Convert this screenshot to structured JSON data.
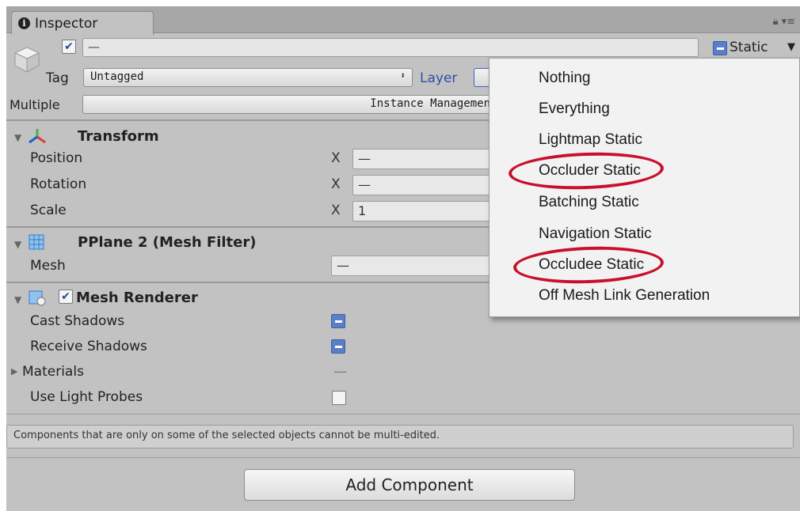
{
  "tab": {
    "title": "Inspector"
  },
  "header": {
    "name_value": "—",
    "static_label": "Static",
    "tag_label": "Tag",
    "tag_value": "Untagged",
    "layer_label": "Layer",
    "multiple_label": "Multiple",
    "multiple_value": "Instance Managemen"
  },
  "transform": {
    "title": "Transform",
    "rows": [
      {
        "label": "Position",
        "axis": "X",
        "value": "—"
      },
      {
        "label": "Rotation",
        "axis": "X",
        "value": "—"
      },
      {
        "label": "Scale",
        "axis": "X",
        "value": "1"
      }
    ]
  },
  "mesh_filter": {
    "title": "PPlane 2 (Mesh Filter)",
    "mesh_label": "Mesh",
    "mesh_value": "—"
  },
  "mesh_renderer": {
    "title": "Mesh Renderer",
    "cast_shadows": "Cast Shadows",
    "receive_shadows": "Receive Shadows",
    "materials": "Materials",
    "materials_value": "—",
    "use_light_probes": "Use Light Probes"
  },
  "static_menu": {
    "items": [
      "Nothing",
      "Everything",
      "Lightmap Static",
      "Occluder Static",
      "Batching Static",
      "Navigation Static",
      "Occludee Static",
      "Off Mesh Link Generation"
    ],
    "circled": [
      "Occluder Static",
      "Occludee Static"
    ],
    "circle_color": "#c8102e"
  },
  "message": "Components that are only on some of the selected objects cannot be multi-edited.",
  "add_component": "Add Component"
}
